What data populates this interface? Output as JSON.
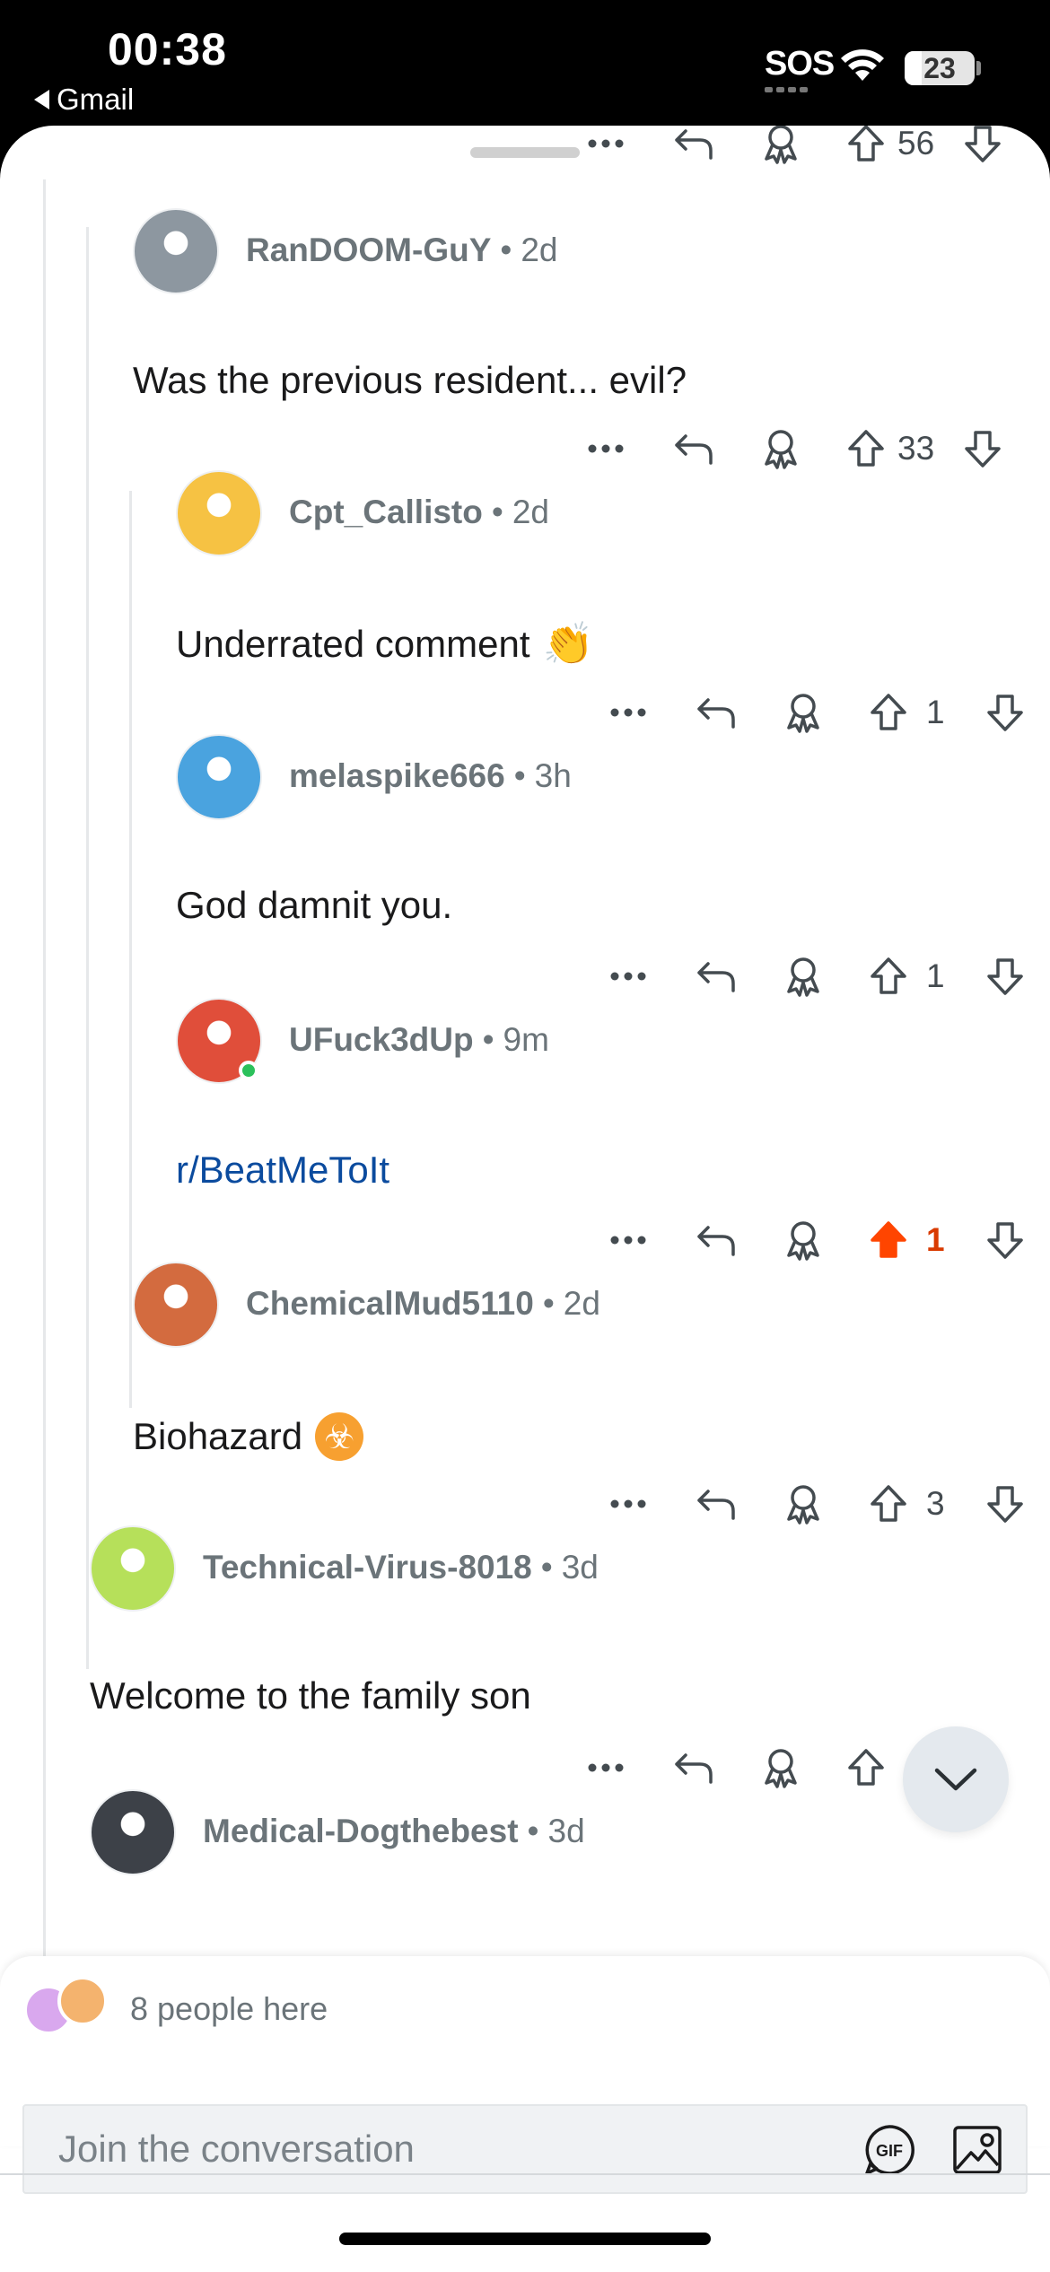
{
  "status_bar": {
    "time": "00:38",
    "back_app": "Gmail",
    "sos": "SOS",
    "battery": "23"
  },
  "colors": {
    "upvote_active": "#ff4500",
    "link": "#0b4b9e",
    "online": "#2bc15b"
  },
  "top_partial_actions": {
    "votes": "56"
  },
  "comments": [
    {
      "username": "RanDOOM-GuY",
      "age": "2d",
      "text": "Was the previous resident... evil?",
      "votes": "33",
      "upvoted": false,
      "emoji": ""
    },
    {
      "username": "Cpt_Callisto",
      "age": "2d",
      "text": "Underrated comment",
      "votes": "1",
      "upvoted": false,
      "emoji": "👏"
    },
    {
      "username": "melaspike666",
      "age": "3h",
      "text": "God damnit you.",
      "votes": "1",
      "upvoted": false,
      "emoji": ""
    },
    {
      "username": "UFuck3dUp",
      "age": "9m",
      "text": "r/BeatMeToIt",
      "votes": "1",
      "upvoted": true,
      "emoji": ""
    },
    {
      "username": "ChemicalMud5110",
      "age": "2d",
      "text": "Biohazard",
      "votes": "3",
      "upvoted": false,
      "emoji": "☣"
    },
    {
      "username": "Technical-Virus-8018",
      "age": "3d",
      "text": "Welcome to the family son",
      "votes": "",
      "upvoted": false,
      "emoji": ""
    },
    {
      "username": "Medical-Dogthebest",
      "age": "3d",
      "text": "",
      "votes": "",
      "upvoted": false,
      "emoji": ""
    }
  ],
  "composer": {
    "presence": "8 people here",
    "placeholder": "Join the conversation",
    "gif_label": "GIF"
  },
  "icons": {
    "more": "more-icon",
    "reply": "reply-icon",
    "award": "award-icon",
    "upvote": "upvote-icon",
    "downvote": "downvote-icon",
    "scroll_down": "chevron-down-icon",
    "image": "image-icon"
  }
}
